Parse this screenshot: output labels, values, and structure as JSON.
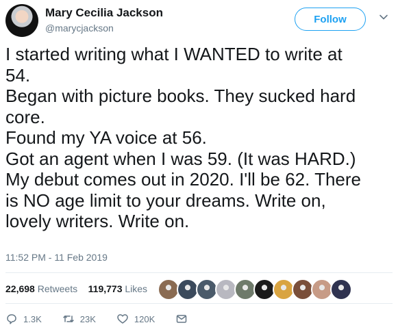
{
  "user": {
    "name": "Mary Cecilia Jackson",
    "handle": "@marycjackson"
  },
  "follow_label": "Follow",
  "tweet": {
    "text": "I started writing what I WANTED to write at\n54.\nBegan with picture books. They sucked hard\ncore.\nFound my YA voice at 56.\nGot an agent when I was 59. (It was HARD.)\nMy debut comes out in 2020. I'll be 62. There\nis NO age limit to your dreams. Write on,\nlovely writers. Write on.",
    "timestamp": "11:52 PM - 11 Feb 2019"
  },
  "stats": {
    "retweets_count": "22,698",
    "retweets_label": "Retweets",
    "likes_count": "119,773",
    "likes_label": "Likes"
  },
  "likers": [
    {
      "icon": "avatar",
      "color": "#8a6b52"
    },
    {
      "icon": "avatar",
      "color": "#3b4a5c"
    },
    {
      "icon": "avatar",
      "color": "#4a5a6a"
    },
    {
      "icon": "avatar",
      "color": "#b8b8c0"
    },
    {
      "icon": "avatar",
      "color": "#6e7a6a"
    },
    {
      "icon": "avatar",
      "color": "#1b1b1b"
    },
    {
      "icon": "avatar",
      "color": "#d9a441"
    },
    {
      "icon": "avatar",
      "color": "#7a4f3a"
    },
    {
      "icon": "avatar",
      "color": "#c79b86"
    },
    {
      "icon": "avatar",
      "color": "#2f3350"
    }
  ],
  "actions": {
    "reply_count": "1.3K",
    "retweet_count": "23K",
    "like_count": "120K"
  },
  "colors": {
    "accent": "#1da1f2",
    "secondary_text": "#657786",
    "divider": "#e6ecf0"
  }
}
